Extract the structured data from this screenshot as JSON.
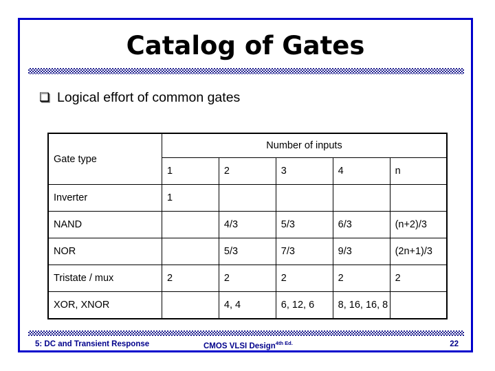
{
  "slide": {
    "title": "Catalog of Gates",
    "border_color": "#0000CC",
    "rule_color": "#1F1F8F"
  },
  "bullet": {
    "glyph": "❑",
    "glyph_name": "hollow-square-bullet",
    "text": "Logical effort of common gates"
  },
  "table": {
    "header_gate_type": "Gate type",
    "header_number_of_inputs": "Number of inputs",
    "input_columns": [
      "1",
      "2",
      "3",
      "4",
      "n"
    ],
    "rows": [
      {
        "gate": "Inverter",
        "cells": [
          "1",
          "",
          "",
          "",
          ""
        ]
      },
      {
        "gate": "NAND",
        "cells": [
          "",
          "4/3",
          "5/3",
          "6/3",
          "(n+2)/3"
        ]
      },
      {
        "gate": "NOR",
        "cells": [
          "",
          "5/3",
          "7/3",
          "9/3",
          "(2n+1)/3"
        ]
      },
      {
        "gate": "Tristate / mux",
        "cells": [
          "2",
          "2",
          "2",
          "2",
          "2"
        ]
      },
      {
        "gate": "XOR, XNOR",
        "cells": [
          "",
          "4, 4",
          "6, 12, 6",
          "8, 16, 16, 8",
          ""
        ]
      }
    ]
  },
  "footer": {
    "left": "5: DC and Transient Response",
    "center_main": "CMOS VLSI Design",
    "center_sup": "4th Ed.",
    "page": "22",
    "color": "#00008B"
  }
}
